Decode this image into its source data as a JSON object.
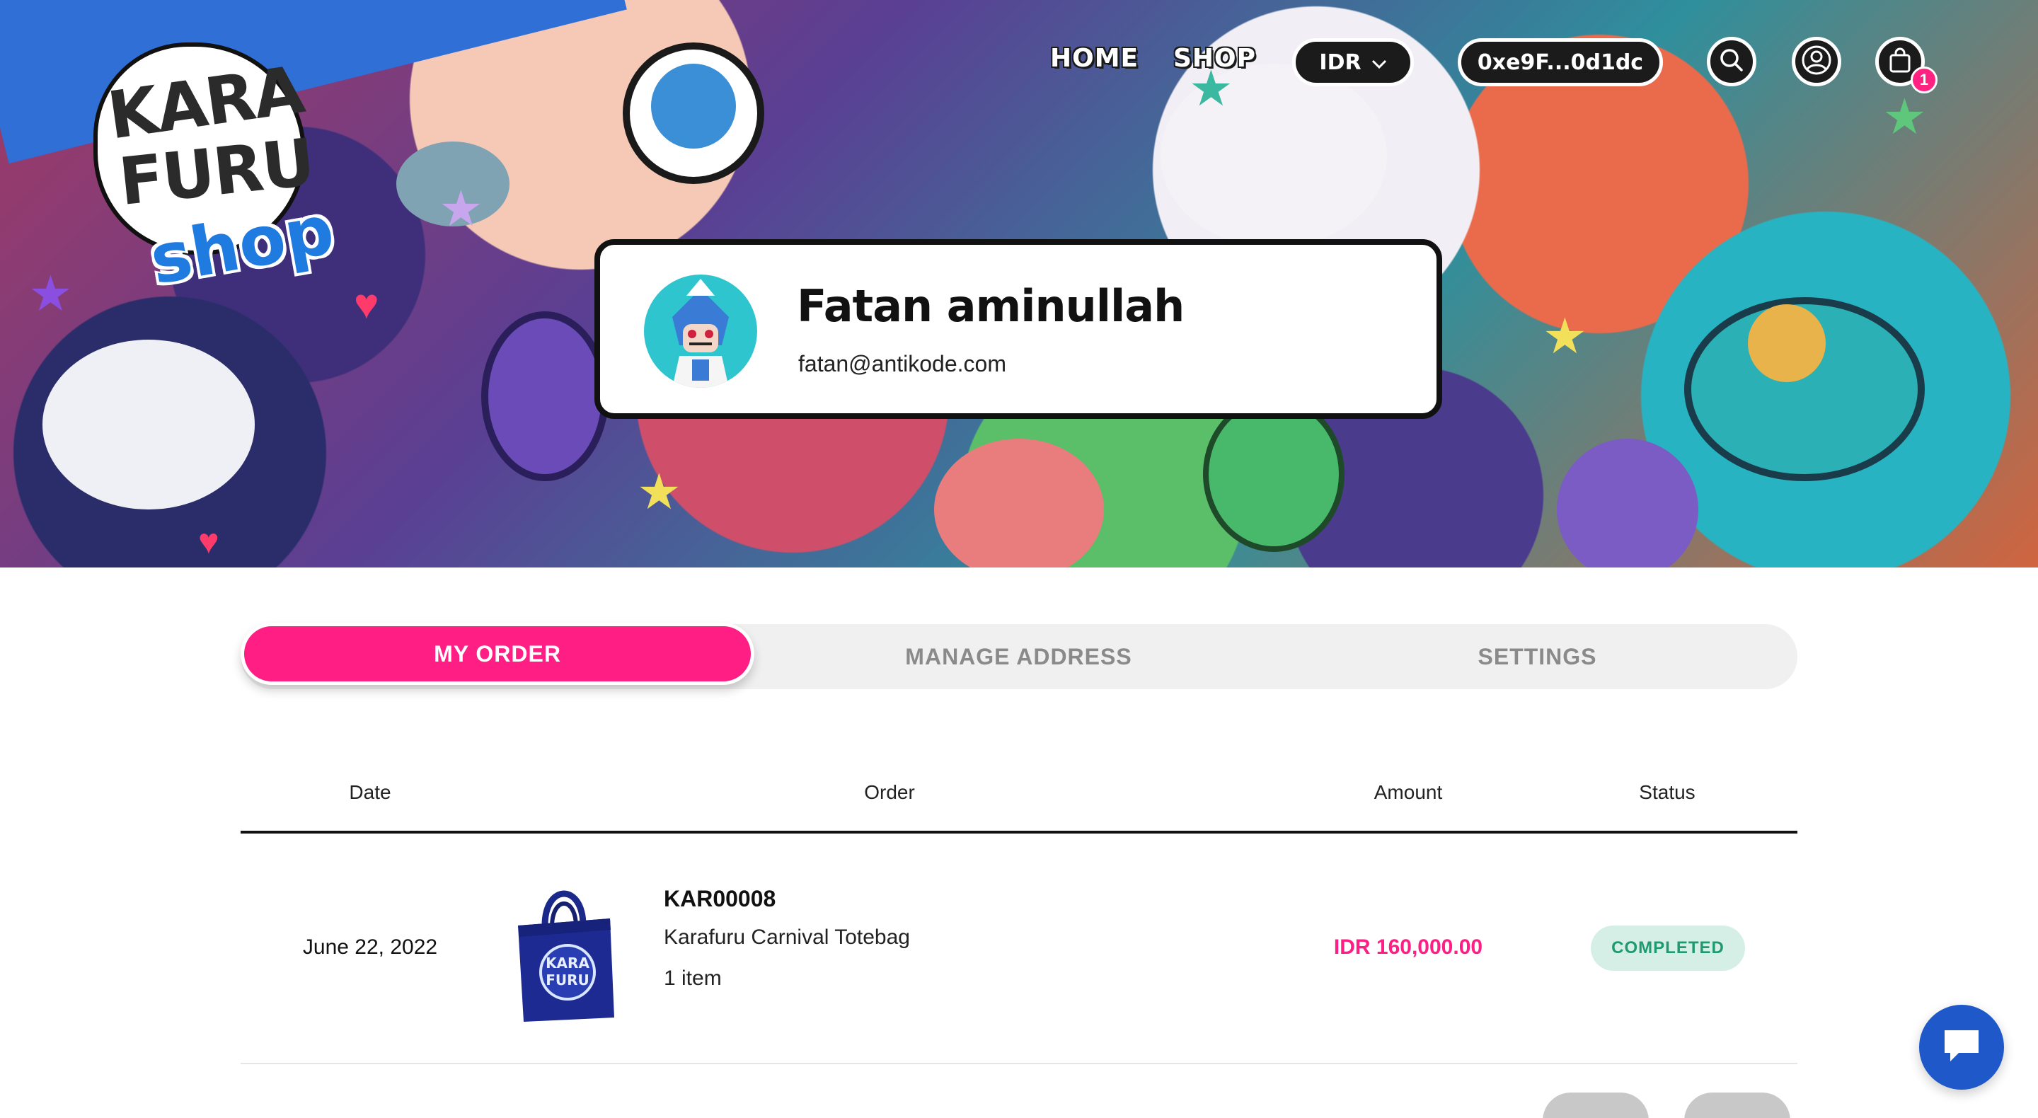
{
  "nav": {
    "home": "HOME",
    "shop": "SHOP",
    "currency": "IDR",
    "wallet": "0xe9F...0d1dc",
    "cart_count": "1"
  },
  "logo": {
    "line1": "KARA",
    "line2": "FURU",
    "line3": "shop"
  },
  "profile": {
    "name": "Fatan aminullah",
    "email": "fatan@antikode.com"
  },
  "tabs": [
    {
      "label": "MY ORDER",
      "active": true
    },
    {
      "label": "MANAGE ADDRESS",
      "active": false
    },
    {
      "label": "SETTINGS",
      "active": false
    }
  ],
  "table": {
    "headers": [
      "Date",
      "Order",
      "Amount",
      "Status"
    ],
    "rows": [
      {
        "date": "June 22, 2022",
        "order_id": "KAR00008",
        "product": "Karafuru Carnival Totebag",
        "quantity": "1 item",
        "amount": "IDR 160,000.00",
        "status": "COMPLETED"
      }
    ]
  },
  "icons": {
    "search": "search-icon",
    "account": "user-icon",
    "cart": "shopping-bag-icon",
    "chat": "chat-icon",
    "currency_dropdown": "chevron-down-icon"
  },
  "colors": {
    "accent": "#ff1f84",
    "status_bg": "#d6efe6",
    "status_text": "#1f9a70",
    "chat": "#1f59c9",
    "nav_pill": "#1b1b1b"
  }
}
